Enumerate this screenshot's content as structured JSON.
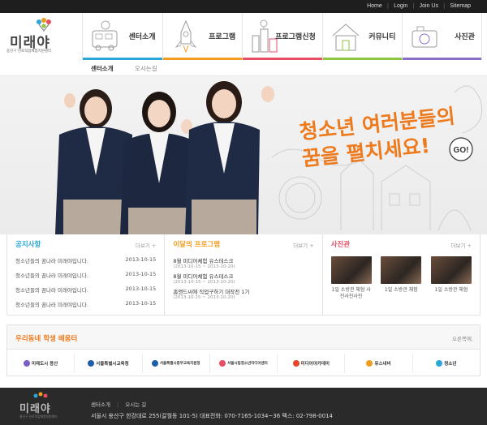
{
  "top_links": [
    "Home",
    "Login",
    "Join Us",
    "Sitemap"
  ],
  "logo": {
    "main": "미래야",
    "sub": "용산구 진로직업체험지원센터"
  },
  "nav": [
    {
      "label": "센터소개",
      "color": "#2aa6d8"
    },
    {
      "label": "프로그램",
      "color": "#f29c1f"
    },
    {
      "label": "프로그램신청",
      "color": "#e84e63"
    },
    {
      "label": "커뮤니티",
      "color": "#8cc63f"
    },
    {
      "label": "사진관",
      "color": "#8a6dc9"
    }
  ],
  "subnav": [
    "센터소개",
    "오시는길"
  ],
  "hero": {
    "slogan_line1": "청소년 여러분들의",
    "slogan_line2": "꿈을 펼치세요!",
    "bubble": "GO!"
  },
  "notice": {
    "title": "공지사항",
    "more": "더보기 +",
    "color": "#2aa6d8",
    "items": [
      {
        "text": "청소년들의 꿈나라 미래야입니다.",
        "date": "2013-10-15"
      },
      {
        "text": "청소년들의 꿈나라 미래야입니다.",
        "date": "2013-10-15"
      },
      {
        "text": "청소년들의 꿈나라 미래야입니다.",
        "date": "2013-10-15"
      },
      {
        "text": "청소년들의 꿈나라 미래야입니다.",
        "date": "2013-10-15"
      }
    ]
  },
  "programs": {
    "title": "이달의 프로그램",
    "more": "더보기 +",
    "color": "#f29c1f",
    "items": [
      {
        "title": "8월 미디어체험 유스테스크",
        "date": "(2013-10-15 ~ 2013-10-20)"
      },
      {
        "title": "8월 미디어체험 유스테스크",
        "date": "(2013-10-15 ~ 2013-10-20)"
      },
      {
        "title": "홈앤드씨에 직업구하기 대작전 1기",
        "date": "(2013-10-15 ~ 2013-10-20)"
      }
    ]
  },
  "gallery": {
    "title": "사진관",
    "more": "더보기 +",
    "color": "#e84e63",
    "items": [
      {
        "caption": "1일 소방관 체험 사진사진사진"
      },
      {
        "caption": "1일 소방관 체험"
      },
      {
        "caption": "1일 소방관 체험"
      }
    ]
  },
  "links": {
    "title": "우리동네 학생 배움터",
    "more": "오른쪽에.",
    "banners": [
      {
        "name": "미래도시 용산",
        "color": "#7b5cc4"
      },
      {
        "name": "서울특별시교육청",
        "color": "#1f5fa8"
      },
      {
        "name": "서울특별시중부교육지원청",
        "color": "#1f5fa8"
      },
      {
        "name": "서울시립청소년미디어센터",
        "color": "#e84e63"
      },
      {
        "name": "미디어아카데미",
        "color": "#e8452b"
      },
      {
        "name": "유스내비",
        "color": "#f29c1f"
      },
      {
        "name": "청소년",
        "color": "#2aa6d8"
      }
    ]
  },
  "footer": {
    "logo_main": "미래야",
    "logo_sub": "용산구 진로직업체험지원센터",
    "links": [
      "센터소개",
      "오시는 길"
    ],
    "address": "서울시 용산구 한강대로 255(갈월동 101-5) 대표전화: 070-7165-1034~36 팩스: 02-798-0014"
  }
}
